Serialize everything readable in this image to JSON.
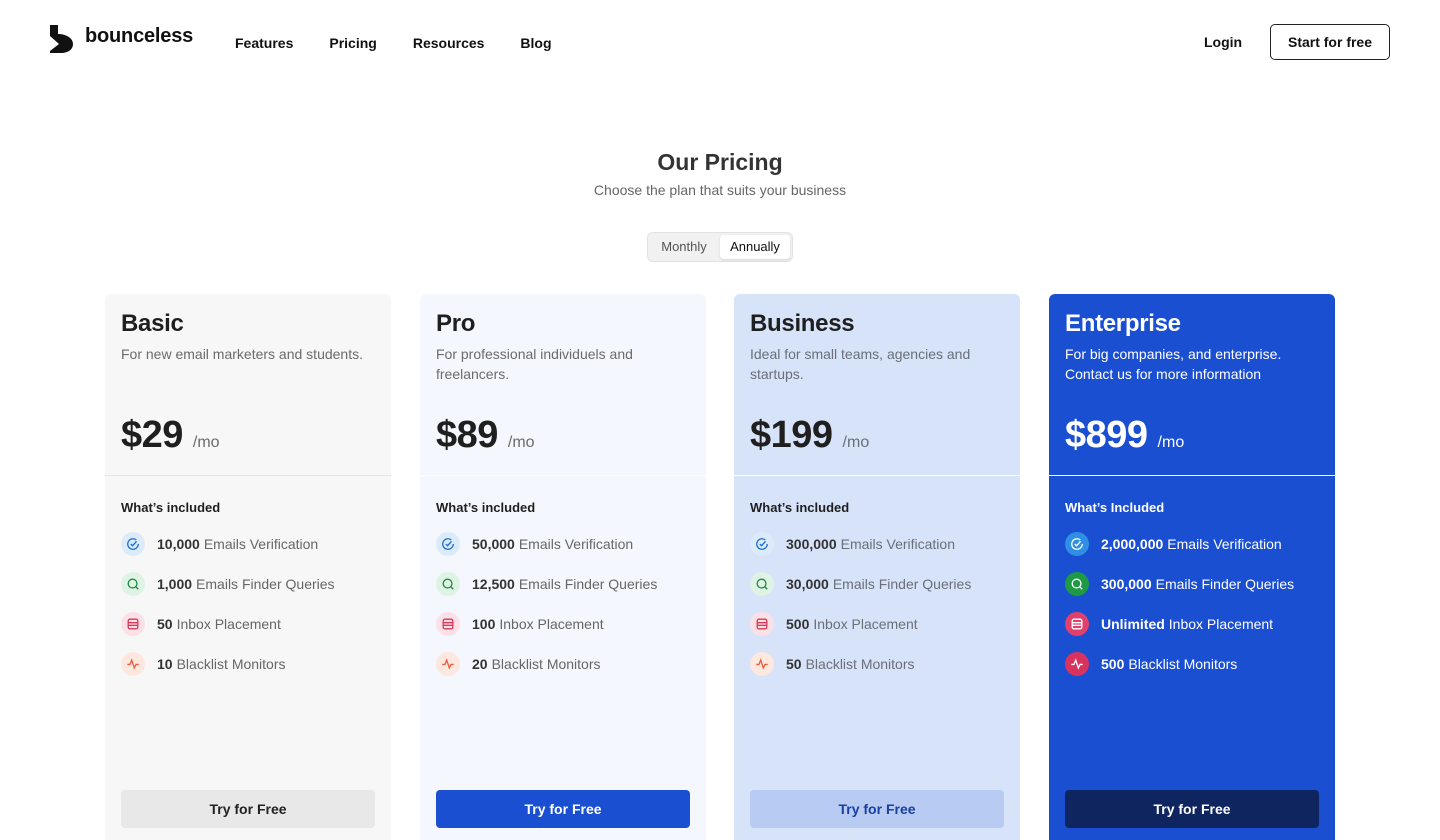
{
  "brand": {
    "name": "bounceless"
  },
  "nav": {
    "items": [
      "Features",
      "Pricing",
      "Resources",
      "Blog"
    ]
  },
  "auth": {
    "login": "Login",
    "start": "Start for free"
  },
  "hero": {
    "title": "Our Pricing",
    "subtitle": "Choose the plan that suits your business"
  },
  "billing": {
    "options": [
      "Monthly",
      "Annually"
    ],
    "selected": "Annually"
  },
  "plans": [
    {
      "name": "Basic",
      "desc": "For new email marketers and students.",
      "price": "$29",
      "period": "/mo",
      "included_label": "What’s included",
      "features": [
        {
          "icon": "check-circle-icon",
          "value": "10,000",
          "label": "Emails Verification"
        },
        {
          "icon": "search-icon",
          "value": "1,000",
          "label": "Emails Finder Queries"
        },
        {
          "icon": "server-icon",
          "value": "50",
          "label": "Inbox Placement"
        },
        {
          "icon": "activity-icon",
          "value": "10",
          "label": "Blacklist Monitors"
        }
      ],
      "cta": "Try for Free"
    },
    {
      "name": "Pro",
      "desc": "For professional individuels and freelancers.",
      "price": "$89",
      "period": "/mo",
      "included_label": "What’s included",
      "features": [
        {
          "icon": "check-circle-icon",
          "value": "50,000",
          "label": "Emails Verification"
        },
        {
          "icon": "search-icon",
          "value": "12,500",
          "label": "Emails Finder Queries"
        },
        {
          "icon": "server-icon",
          "value": "100",
          "label": "Inbox Placement"
        },
        {
          "icon": "activity-icon",
          "value": "20",
          "label": "Blacklist Monitors"
        }
      ],
      "cta": "Try for Free"
    },
    {
      "name": "Business",
      "desc": "Ideal for small teams, agencies and startups.",
      "price": "$199",
      "period": "/mo",
      "included_label": "What’s included",
      "features": [
        {
          "icon": "check-circle-icon",
          "value": "300,000",
          "label": "Emails Verification"
        },
        {
          "icon": "search-icon",
          "value": "30,000",
          "label": "Emails Finder Queries"
        },
        {
          "icon": "server-icon",
          "value": "500",
          "label": "Inbox Placement"
        },
        {
          "icon": "activity-icon",
          "value": "50",
          "label": "Blacklist Monitors"
        }
      ],
      "cta": "Try for Free"
    },
    {
      "name": "Enterprise",
      "desc": "For big companies, and enterprise. Contact us for more information",
      "price": "$899",
      "period": "/mo",
      "included_label": "What’s Included",
      "features": [
        {
          "icon": "check-circle-icon",
          "value": "2,000,000",
          "label": "Emails Verification"
        },
        {
          "icon": "search-icon",
          "value": "300,000",
          "label": "Emails Finder Queries"
        },
        {
          "icon": "server-icon",
          "value": "Unlimited",
          "label": "Inbox Placement"
        },
        {
          "icon": "activity-icon",
          "value": "500",
          "label": "Blacklist Monitors"
        }
      ],
      "cta": "Try for Free"
    }
  ],
  "colors": {
    "primary": "#1a4fd1",
    "enterprise_cta": "#0e2560",
    "business_bg": "#d7e3f9",
    "pro_bg": "#f4f7fd",
    "basic_bg": "#f7f7f7"
  }
}
